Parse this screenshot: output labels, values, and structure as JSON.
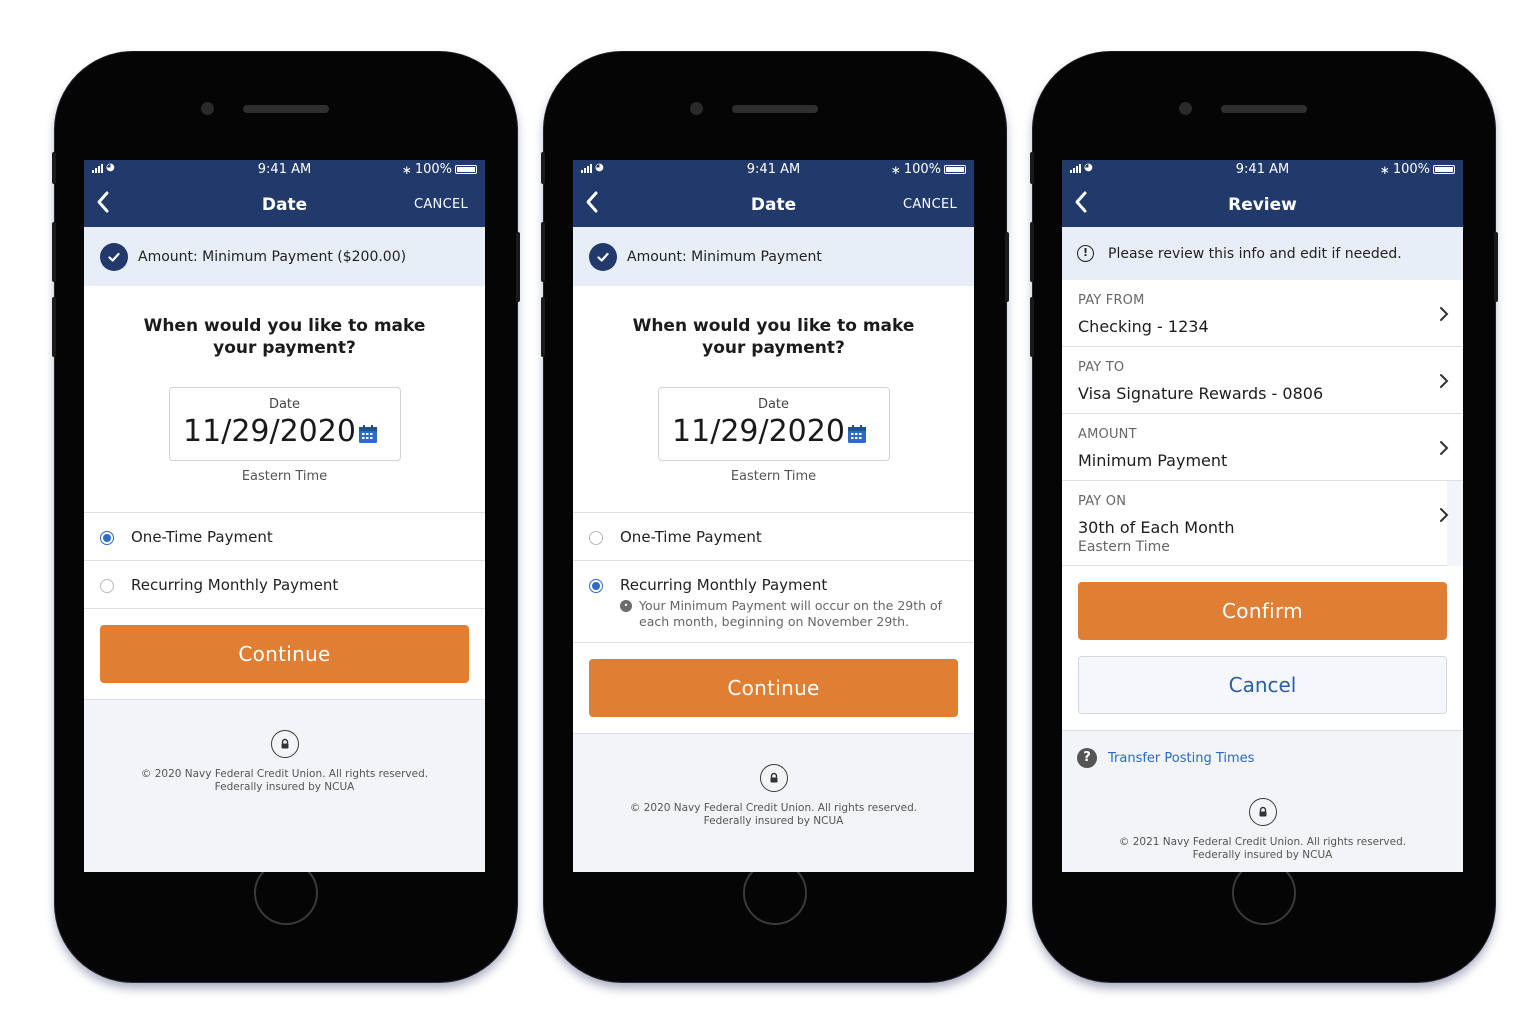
{
  "status_bar": {
    "time": "9:41 AM",
    "battery": "100%",
    "bluetooth": "bluetooth-icon"
  },
  "footer_2020": {
    "copyright": "© 2020 Navy Federal Credit Union. All rights reserved.",
    "insured": "Federally insured by NCUA"
  },
  "phone1": {
    "nav": {
      "title": "Date",
      "cancel": "CANCEL"
    },
    "banner": "Amount: Minimum Payment ($200.00)",
    "question": "When would you like to make your payment?",
    "date": {
      "label": "Date",
      "value": "11/29/2020",
      "timezone": "Eastern Time"
    },
    "options": [
      {
        "label": "One-Time Payment",
        "selected": true
      },
      {
        "label": "Recurring Monthly Payment",
        "selected": false
      }
    ],
    "continue": "Continue"
  },
  "phone2": {
    "nav": {
      "title": "Date",
      "cancel": "CANCEL"
    },
    "banner": "Amount: Minimum Payment",
    "question": "When would you like to make your payment?",
    "date": {
      "label": "Date",
      "value": "11/29/2020",
      "timezone": "Eastern Time"
    },
    "options": [
      {
        "label": "One-Time Payment",
        "selected": false
      },
      {
        "label": "Recurring Monthly Payment",
        "selected": true,
        "note": "Your Minimum Payment will occur on the 29th of each month, beginning on November 29th."
      }
    ],
    "continue": "Continue"
  },
  "phone3": {
    "nav": {
      "title": "Review"
    },
    "banner": "Please review this info and edit if needed.",
    "rows": [
      {
        "label": "PAY FROM",
        "value": "Checking - 1234"
      },
      {
        "label": "PAY TO",
        "value": "Visa Signature Rewards - 0806"
      },
      {
        "label": "AMOUNT",
        "value": "Minimum Payment"
      },
      {
        "label": "PAY ON",
        "value": "30th of Each Month",
        "sub": "Eastern Time"
      }
    ],
    "confirm": "Confirm",
    "cancel": "Cancel",
    "help_link": "Transfer Posting Times",
    "copyright": "© 2021 Navy Federal Credit Union. All rights reserved.",
    "insured": "Federally insured by NCUA"
  },
  "colors": {
    "navy": "#213a6b",
    "orange": "#e07f34",
    "link_blue": "#2a6abf",
    "radio_blue": "#2d6bc9"
  }
}
